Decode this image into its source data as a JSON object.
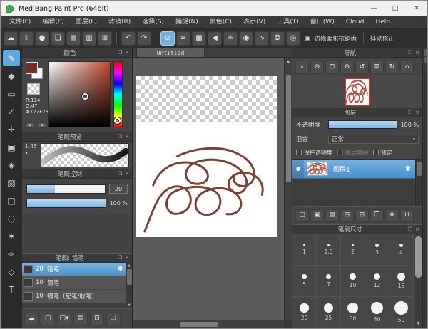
{
  "ui": {
    "popout": "❐",
    "close": "×",
    "close_win": "✕",
    "minimize": "—",
    "maximize": "□",
    "dropdown": "▾",
    "up": "▲",
    "down": "▼",
    "gear": "✽",
    "dot": "●",
    "frame": "▣",
    "pill": "▪"
  },
  "window": {
    "title": "MediBang Paint Pro (64bit)"
  },
  "menu": {
    "items": [
      "文件(F)",
      "编辑(E)",
      "图层(L)",
      "滤镜(R)",
      "选择(S)",
      "捕捉(N)",
      "颜色(C)",
      "表示(V)",
      "工具(T)",
      "窗口(W)",
      "Cloud",
      "Help"
    ]
  },
  "toolbar": {
    "g1": [
      {
        "id": "cloud-button",
        "g": "☁"
      },
      {
        "id": "publish-button",
        "g": "⇧"
      },
      {
        "id": "comment-button",
        "g": "●"
      },
      {
        "id": "chat-button",
        "g": "❏"
      },
      {
        "id": "document-button",
        "g": "▤"
      },
      {
        "id": "panel-list-button",
        "g": "▥"
      },
      {
        "id": "material-grid-button",
        "g": "⊞"
      }
    ],
    "g2": [
      {
        "id": "undo-button",
        "g": "↶"
      },
      {
        "id": "redo-button",
        "g": "↷"
      }
    ],
    "g3": [
      {
        "id": "snap-off-button",
        "g": "⊘",
        "active": true
      },
      {
        "id": "snap-parallel-button",
        "g": "≡"
      },
      {
        "id": "snap-grid-button",
        "g": "▦"
      },
      {
        "id": "snap-vanishing-button",
        "g": "◀"
      },
      {
        "id": "snap-radial-button",
        "g": "✳"
      },
      {
        "id": "snap-circle-button",
        "g": "◉"
      },
      {
        "id": "snap-curve-button",
        "g": "∿"
      },
      {
        "id": "snap-ellipse-button",
        "g": "❂"
      },
      {
        "id": "snap-concentric-button",
        "g": "◎"
      }
    ],
    "antialias": "边缘柔化抗锯齿",
    "stabilizer": "抖动修正"
  },
  "tools": {
    "items": [
      {
        "id": "brush-tool",
        "g": "✎",
        "active": true
      },
      {
        "id": "eraser-tool",
        "g": "◆"
      },
      {
        "id": "shape-tool",
        "g": "▭"
      },
      {
        "id": "operation-tool",
        "g": "✓"
      },
      {
        "id": "move-tool",
        "g": "✛"
      },
      {
        "id": "select-tool",
        "g": "▣"
      },
      {
        "id": "bucket-tool",
        "g": "◈"
      },
      {
        "id": "gradient-tool",
        "g": "▧"
      },
      {
        "id": "select-rect-tool",
        "g": "□"
      },
      {
        "id": "lasso-tool",
        "g": "◌"
      },
      {
        "id": "magic-wand-tool",
        "g": "✶"
      },
      {
        "id": "select-pen-tool",
        "g": "✑"
      },
      {
        "id": "select-eraser-tool",
        "g": "◇"
      },
      {
        "id": "text-tool",
        "g": "T"
      }
    ]
  },
  "color_panel": {
    "title": "颜色",
    "r": "R:114",
    "g": "G:47",
    "hex": "#722F23",
    "fg": "#722f23",
    "buttons": [
      {
        "id": "palette-tab-button",
        "g": "▪"
      },
      {
        "id": "swatch-tab-button",
        "g": "▪"
      }
    ]
  },
  "brush_preview": {
    "title": "笔刷预览",
    "zoom": "1.45",
    "marker": "•"
  },
  "brush_control": {
    "title": "笔刷控制",
    "size": "20",
    "opacity": "100",
    "unit": "%"
  },
  "brush_list": {
    "title": "笔刷: 铅笔",
    "items": [
      {
        "id": "brush-pencil",
        "size": "20",
        "label": "铅笔",
        "selected": true
      },
      {
        "id": "brush-pen",
        "size": "10",
        "label": "钢笔"
      },
      {
        "id": "brush-pen-inout",
        "size": "10",
        "label": "钢笔（起笔/收笔）"
      }
    ],
    "footer": [
      {
        "id": "brush-cloud-button",
        "g": "☁"
      },
      {
        "id": "brush-add-button",
        "g": "▢"
      },
      {
        "id": "brush-add-menu-button",
        "g": "▢▾"
      },
      {
        "id": "brush-edit-button",
        "g": "▤"
      },
      {
        "id": "brush-folder-button",
        "g": "⊟"
      },
      {
        "id": "brush-duplicate-button",
        "g": "❐"
      }
    ]
  },
  "canvas": {
    "tab": "Untitled"
  },
  "navigator": {
    "title": "导航",
    "buttons": [
      {
        "id": "zoom-reset-button",
        "g": "⌕"
      },
      {
        "id": "zoom-in-button",
        "g": "⊕"
      },
      {
        "id": "fit-screen-button",
        "g": "⊡"
      },
      {
        "id": "zoom-out-button",
        "g": "⊖"
      },
      {
        "id": "rotate-left-button",
        "g": "↺"
      },
      {
        "id": "reset-rotation-button",
        "g": "⊠"
      },
      {
        "id": "rotate-right-button",
        "g": "↻"
      },
      {
        "id": "lock-view-button",
        "g": "⌂"
      }
    ]
  },
  "layers": {
    "title": "图层",
    "opacity_label": "不透明度",
    "opacity_value": "100",
    "unit": "%",
    "blend_label": "混合",
    "blend_value": "正常",
    "checks": [
      {
        "id": "protect-alpha-checkbox",
        "label": "保护透明度"
      },
      {
        "id": "clipping-checkbox",
        "label": "图层剪贴",
        "dim": true
      },
      {
        "id": "lock-checkbox",
        "label": "锁定"
      }
    ],
    "items": [
      {
        "id": "layer-1",
        "label": "图层1",
        "selected": true
      }
    ],
    "footer": [
      {
        "id": "add-layer-button",
        "g": "▢"
      },
      {
        "id": "add-halftone-layer-button",
        "g": "▣"
      },
      {
        "id": "add-1bit-layer-button",
        "g": "▤"
      },
      {
        "id": "add-layer-menu-button",
        "g": "⊞"
      },
      {
        "id": "add-folder-button",
        "g": "⊟"
      },
      {
        "id": "duplicate-layer-button",
        "g": "❐"
      },
      {
        "id": "transfer-layer-button",
        "g": "❖"
      },
      {
        "id": "delete-layer-button",
        "g": "⊔",
        "cls": "overline"
      }
    ]
  },
  "brush_size": {
    "title": "笔刷尺寸",
    "sizes": [
      1,
      1.5,
      2,
      3,
      4,
      5,
      7,
      10,
      12,
      15,
      20,
      25,
      30,
      40,
      50
    ]
  }
}
